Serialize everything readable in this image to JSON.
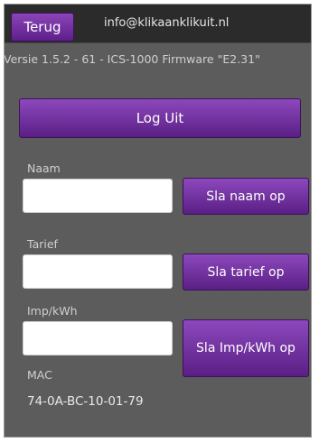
{
  "header": {
    "back_label": "Terug",
    "email": "info@klikaanklikuit.nl"
  },
  "version_text": "Versie 1.5.2 - 61 - ICS-1000 Firmware \"E2.31\"",
  "logout_label": "Log Uit",
  "fields": {
    "name": {
      "label": "Naam",
      "value": "",
      "button": "Sla naam op"
    },
    "tariff": {
      "label": "Tarief",
      "value": "",
      "button": "Sla tarief op"
    },
    "imp": {
      "label": "Imp/kWh",
      "value": "",
      "button": "Sla Imp/kWh op"
    }
  },
  "mac": {
    "label": "MAC",
    "value": "74-0A-BC-10-01-79"
  },
  "colors": {
    "accent_purple": "#6e2f9c",
    "background": "#5c5c5c"
  }
}
